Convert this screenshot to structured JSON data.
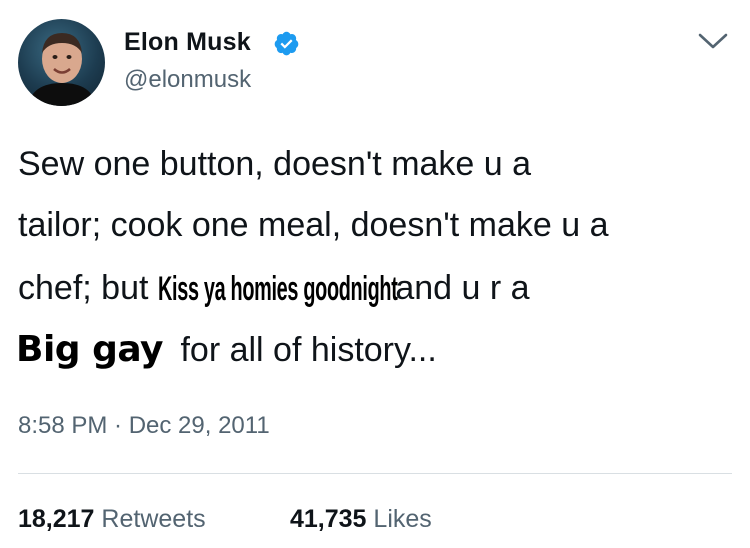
{
  "author": {
    "display_name": "Elon Musk",
    "handle": "@elonmusk",
    "verified": true,
    "verified_icon": "verified-badge-icon",
    "verified_color": "#1d9bf0"
  },
  "menu": {
    "icon": "chevron-down-icon"
  },
  "tweet": {
    "line1": "Sew one button, doesn't make u a",
    "line2": "tailor; cook one meal, doesn't make u a",
    "line3_start": "chef; but ",
    "overlay_text_1": "Kiss ya homies goodnight",
    "line3_end": " and u r a",
    "overlay_text_2": "Big gay",
    "line4_end": " for all of history..."
  },
  "timestamp": "8:58 PM · Dec 29, 2011",
  "stats": {
    "retweets_count": "18,217",
    "retweets_label": "Retweets",
    "likes_count": "41,735",
    "likes_label": "Likes"
  },
  "colors": {
    "text": "#0f1419",
    "secondary": "#536471",
    "divider": "#d9dfe3",
    "accent": "#1d9bf0"
  }
}
